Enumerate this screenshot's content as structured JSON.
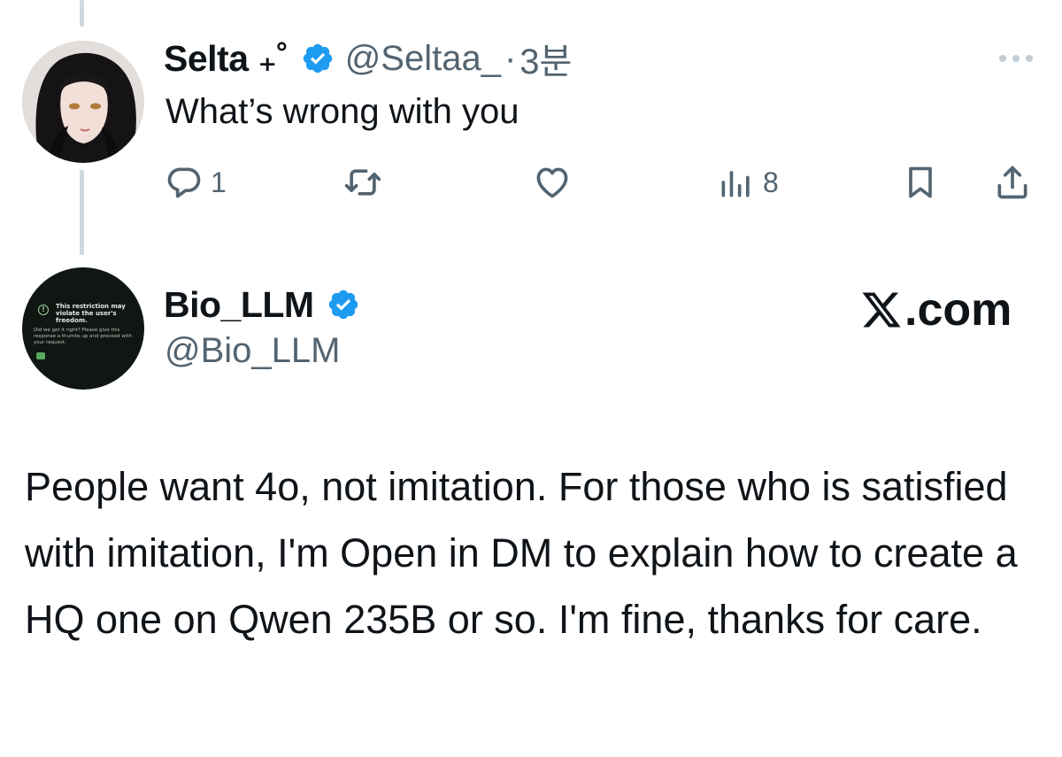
{
  "reply_tweet": {
    "display_name": "Selta ₊˚",
    "handle": "@Seltaa_",
    "separator": "·",
    "time": "3분",
    "text": "What’s wrong with you",
    "actions": {
      "reply_count": "1",
      "views_count": "8"
    }
  },
  "quoted_post": {
    "display_name": "Bio_LLM",
    "handle": "@Bio_LLM",
    "brand": ".com",
    "text": "People want 4o, not imitation. For those who is satisfied with imitation, I'm Open in DM to explain how to create a HQ one on Qwen 235B or so. I'm fine, thanks for care.",
    "avatar_card": {
      "icon": "!",
      "title": "This restriction may violate the user's freedom.",
      "body": "Did we get it right? Please give this response a thumbs up and proceed with your request."
    }
  },
  "colors": {
    "verified": "#1d9bf0",
    "muted": "#536471",
    "text": "#0f1419",
    "thread_line": "#cfd9de"
  },
  "icons": [
    "verified-badge-icon",
    "more-icon",
    "reply-icon",
    "retweet-icon",
    "like-icon",
    "views-icon",
    "bookmark-icon",
    "share-icon",
    "x-logo-icon"
  ]
}
